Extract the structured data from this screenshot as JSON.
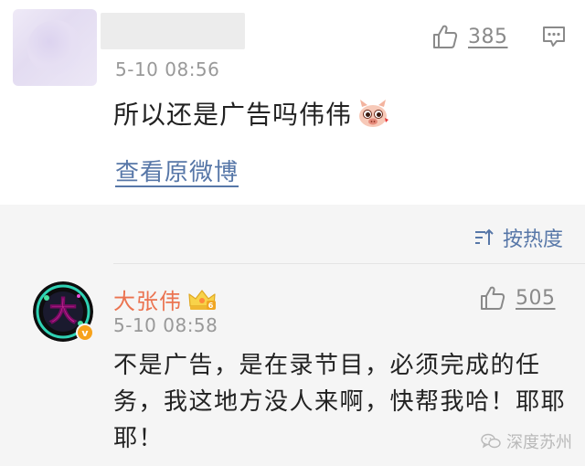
{
  "top_comment": {
    "like_count": "385",
    "time": "5-10 08:56",
    "text": "所以还是广告吗伟伟",
    "view_original": "查看原微博"
  },
  "sort": {
    "label": "按热度"
  },
  "reply": {
    "username": "大张伟",
    "like_count": "505",
    "time": "5-10 08:58",
    "text": "不是广告，是在录节目，必须完成的任务，我这地方没人来啊，快帮我哈！耶耶耶！",
    "avatar_char": "大",
    "verified_badge": "v"
  },
  "watermark": {
    "text": "深度苏州"
  },
  "colors": {
    "link_blue": "#5777a8",
    "username_orange": "#eb7350",
    "section_grey": "#f5f5f5",
    "meta_grey": "#999999"
  },
  "icons": [
    "thumbs-up-icon",
    "reply-bubble-icon",
    "sort-icon",
    "pig-emoji-icon",
    "crown-icon",
    "verified-badge-icon",
    "wechat-icon"
  ]
}
